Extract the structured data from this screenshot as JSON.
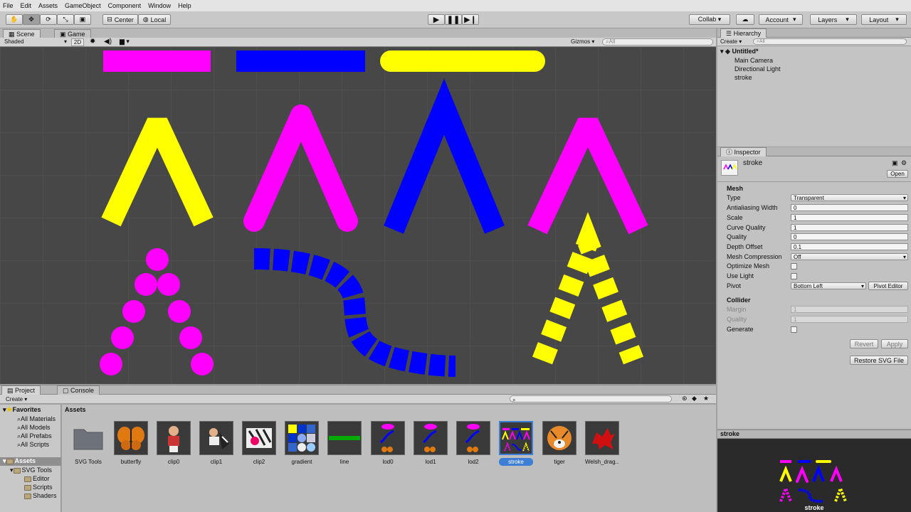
{
  "menu": [
    "File",
    "Edit",
    "Assets",
    "GameObject",
    "Component",
    "Window",
    "Help"
  ],
  "toolbar": {
    "center_label": "Center",
    "local_label": "Local",
    "collab_label": "Collab ▾",
    "account_label": "Account",
    "layers_label": "Layers",
    "layout_label": "Layout"
  },
  "scene": {
    "tab_scene": "Scene",
    "tab_game": "Game",
    "shading_mode": "Shaded",
    "mode_2d": "2D",
    "gizmos_label": "Gizmos",
    "search_placeholder": "All"
  },
  "hierarchy": {
    "title": "Hierarchy",
    "create_label": "Create",
    "search_placeholder": "All",
    "scene_name": "Untitled*",
    "items": [
      "Main Camera",
      "Directional Light",
      "stroke"
    ]
  },
  "inspector": {
    "title": "Inspector",
    "object_name": "stroke",
    "open_label": "Open",
    "mesh_section": "Mesh",
    "mesh_fields": [
      {
        "label": "Type",
        "value": "Transparent",
        "kind": "drop"
      },
      {
        "label": "Antialiasing Width",
        "value": "0",
        "kind": "text"
      },
      {
        "label": "Scale",
        "value": "1",
        "kind": "text"
      },
      {
        "label": "Curve Quality",
        "value": "1",
        "kind": "text"
      },
      {
        "label": "Quality",
        "value": "0",
        "kind": "text"
      },
      {
        "label": "Depth Offset",
        "value": "0.1",
        "kind": "text"
      },
      {
        "label": "Mesh Compression",
        "value": "Off",
        "kind": "drop"
      },
      {
        "label": "Optimize Mesh",
        "value": "",
        "kind": "check"
      },
      {
        "label": "Use Light",
        "value": "",
        "kind": "check"
      }
    ],
    "pivot_label": "Pivot",
    "pivot_value": "Bottom Left",
    "pivot_editor_label": "Pivot Editor",
    "collider_section": "Collider",
    "collider_fields": [
      {
        "label": "Margin",
        "value": "1",
        "kind": "text"
      },
      {
        "label": "Quality",
        "value": "1",
        "kind": "text"
      }
    ],
    "generate_label": "Generate",
    "revert_label": "Revert",
    "apply_label": "Apply",
    "restore_label": "Restore SVG File"
  },
  "project": {
    "tab_project": "Project",
    "tab_console": "Console",
    "create_label": "Create",
    "favorites_label": "Favorites",
    "favorites": [
      "All Materials",
      "All Models",
      "All Prefabs",
      "All Scripts"
    ],
    "assets_root": "Assets",
    "assets_tree": [
      "SVG Tools",
      "Editor",
      "Scripts",
      "Shaders"
    ],
    "breadcrumb": "Assets",
    "assets": [
      "SVG Tools",
      "butterfly",
      "clip0",
      "clip1",
      "clip2",
      "gradient",
      "line",
      "lod0",
      "lod1",
      "lod2",
      "stroke",
      "tiger",
      "Welsh_drag..."
    ],
    "selected_asset": "stroke"
  },
  "preview": {
    "title": "stroke",
    "caption": "stroke"
  },
  "colors": {
    "magenta": "#ff00ff",
    "blue": "#0000ff",
    "yellow": "#ffff00",
    "selection": "#3d7fd6"
  }
}
